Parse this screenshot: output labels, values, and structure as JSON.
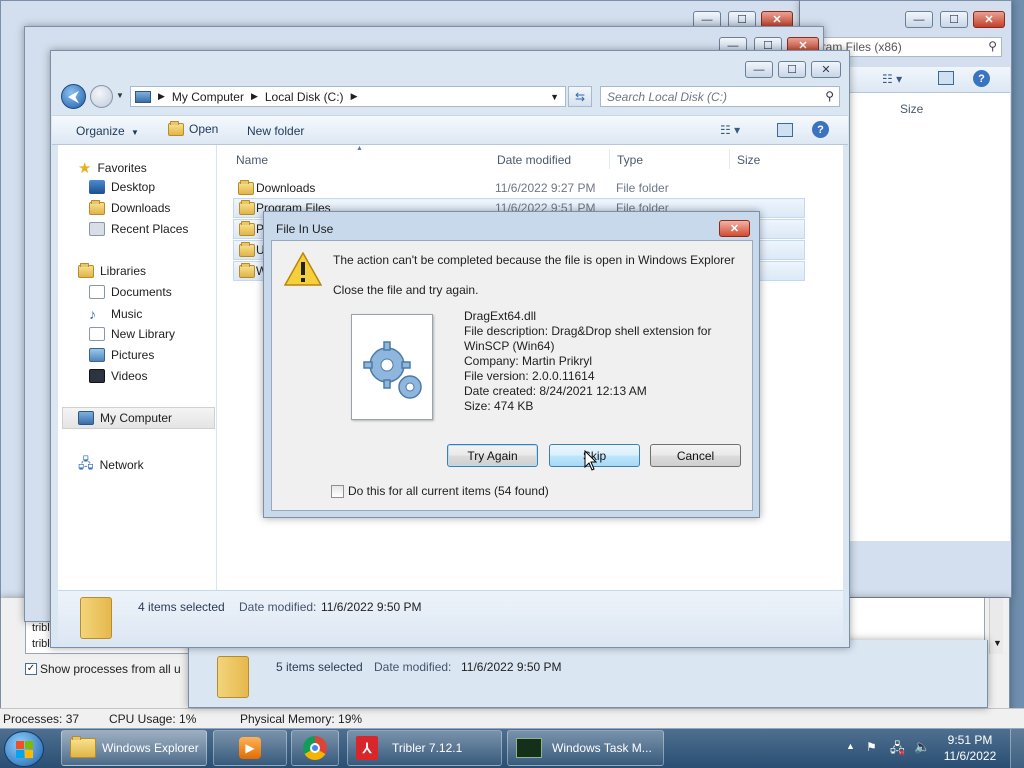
{
  "back_window_right": {
    "search_text": "gram Files (x86)",
    "col_size": "Size",
    "status_text": "5 items selected",
    "date_label": "Date modified:",
    "date_value": "11/6/2022 9:50 PM"
  },
  "task_manager": {
    "rows": [
      "tribl",
      "tribl"
    ],
    "show_all_label": "Show processes from all u",
    "status": {
      "processes": "Processes: 37",
      "cpu": "CPU Usage: 1%",
      "memory": "Physical Memory: 19%"
    }
  },
  "explorer": {
    "breadcrumb": [
      "My Computer",
      "Local Disk (C:)"
    ],
    "search_placeholder": "Search Local Disk (C:)",
    "toolbar": {
      "organize": "Organize",
      "open": "Open",
      "new_folder": "New folder"
    },
    "nav": {
      "favorites": "Favorites",
      "favorites_items": [
        "Desktop",
        "Downloads",
        "Recent Places"
      ],
      "libraries": "Libraries",
      "library_items": [
        "Documents",
        "Music",
        "New Library",
        "Pictures",
        "Videos"
      ],
      "computer": "My Computer",
      "network": "Network"
    },
    "columns": {
      "name": "Name",
      "date": "Date modified",
      "type": "Type",
      "size": "Size"
    },
    "files": [
      {
        "name": "Downloads",
        "date": "11/6/2022 9:27 PM",
        "type": "File folder"
      },
      {
        "name": "Program Files",
        "date": "11/6/2022 9:51 PM",
        "type": "File folder"
      },
      {
        "name": "P",
        "date": "",
        "type": ""
      },
      {
        "name": "U",
        "date": "",
        "type": ""
      },
      {
        "name": "W",
        "date": "",
        "type": ""
      }
    ],
    "status": {
      "selected": "4 items selected",
      "date_label": "Date modified:",
      "date_value": "11/6/2022 9:50 PM"
    }
  },
  "dialog": {
    "title": "File In Use",
    "message": "The action can't be completed because the file is open in Windows Explorer",
    "instruction": "Close the file and try again.",
    "file_name": "DragExt64.dll",
    "desc_line1": "File description: Drag&Drop shell extension for",
    "desc_line2": "WinSCP (Win64)",
    "company": "Company: Martin Prikryl",
    "version": "File version: 2.0.0.11614",
    "created": "Date created: 8/24/2021 12:13 AM",
    "size": "Size: 474 KB",
    "buttons": {
      "try_again": "Try Again",
      "skip": "Skip",
      "cancel": "Cancel"
    },
    "checkbox_label": "Do this for all current items (54 found)"
  },
  "taskbar": {
    "items": [
      "Windows Explorer",
      "Tribler 7.12.1",
      "Windows Task M..."
    ],
    "time": "9:51 PM",
    "date": "11/6/2022"
  },
  "colors": {
    "accent": "#3c7fb1",
    "selection": "#dce9f7",
    "taskbar": "#2a4f73"
  }
}
